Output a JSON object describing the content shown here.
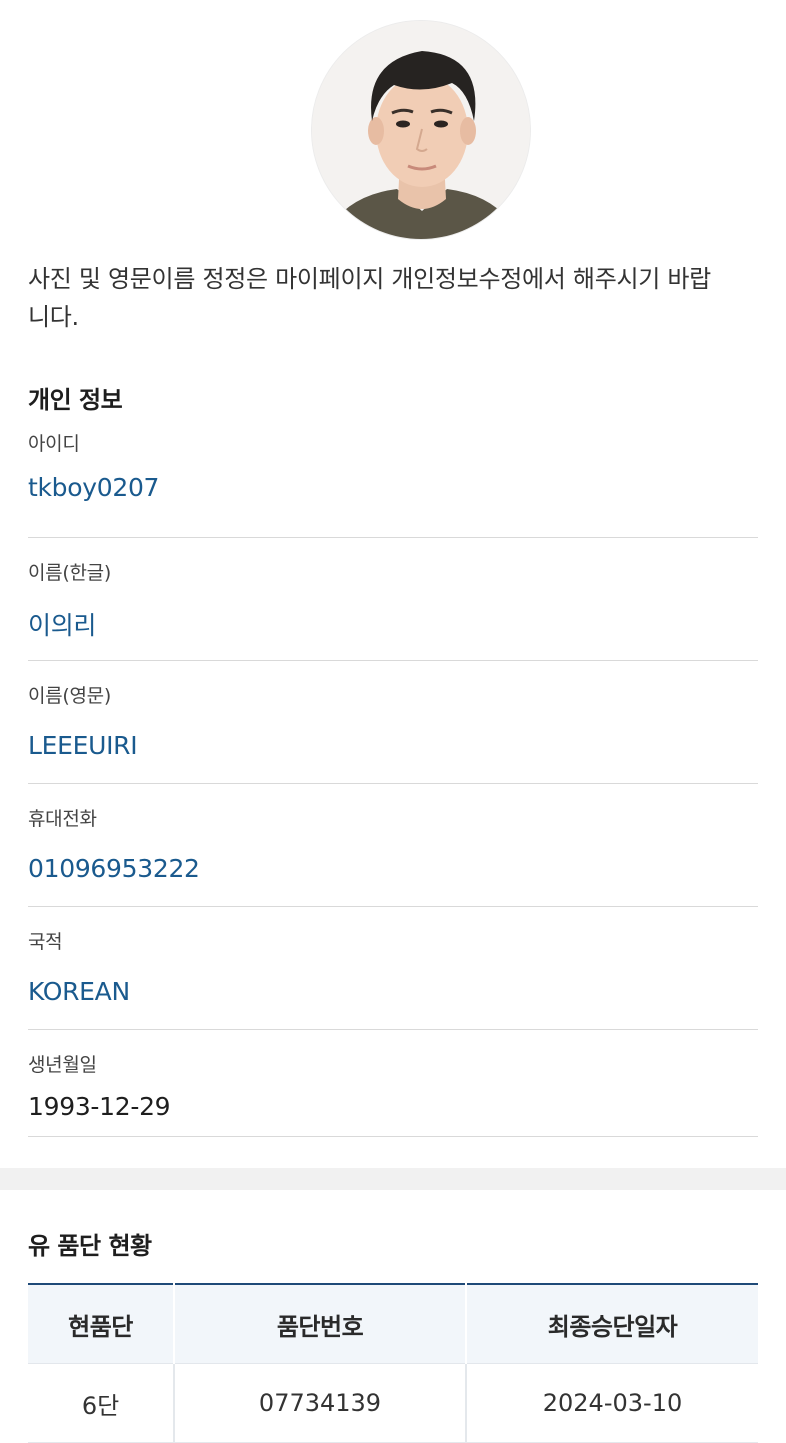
{
  "profile": {
    "photo_alt": "profile-photo",
    "notice": "사진 및 영문이름 정정은 마이페이지 개인정보수정에서 해주시기 바랍니다."
  },
  "personal": {
    "title": "개인 정보",
    "fields": [
      {
        "label": "아이디",
        "value": "tkboy0207"
      },
      {
        "label": "이름(한글)",
        "value": "이의리"
      },
      {
        "label": "이름(영문)",
        "value": "LEEEUIRI"
      },
      {
        "label": "휴대전화",
        "value": "01096953222"
      },
      {
        "label": "국적",
        "value": "KOREAN"
      },
      {
        "label": "생년월일",
        "value": "1993-12-29"
      }
    ]
  },
  "dan_status": {
    "title": "유 품단 현황",
    "columns": [
      "현품단",
      "품단번호",
      "최종승단일자"
    ],
    "rows": [
      [
        "6단",
        "07734139",
        "2024-03-10"
      ]
    ]
  },
  "colors": {
    "link_value": "#1a5a8e",
    "table_header_bg": "#f2f6fa",
    "table_top_border": "#1f4a78",
    "band": "#f1f1f1"
  }
}
